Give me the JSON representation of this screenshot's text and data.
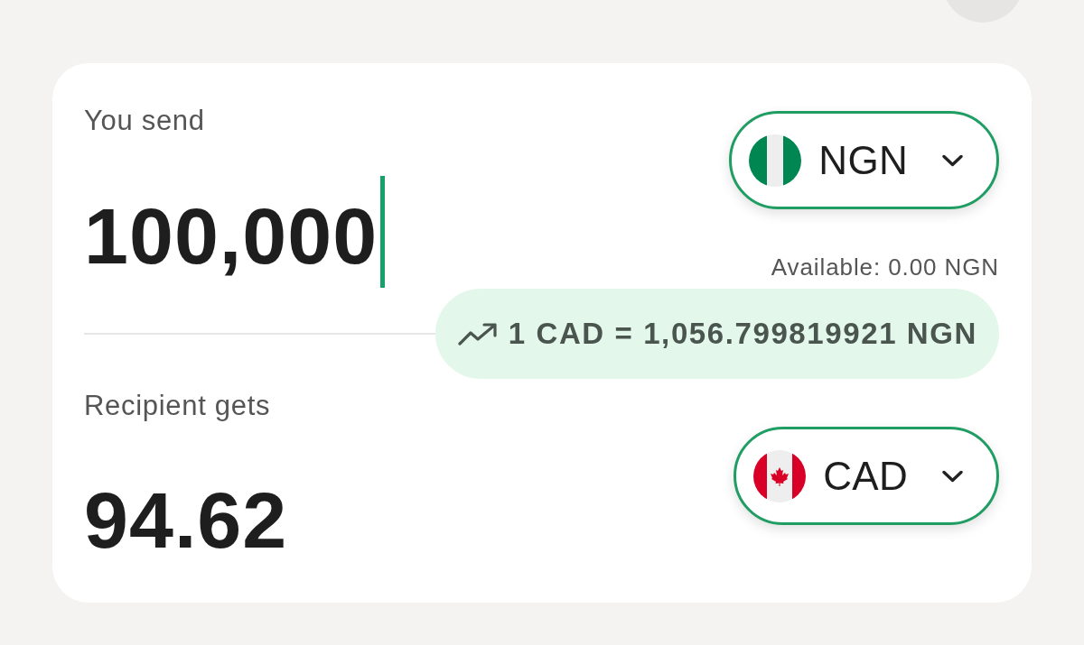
{
  "send": {
    "label": "You send",
    "amount": "100,000",
    "focused": true,
    "currency": {
      "code": "NGN",
      "kind": "nigeria"
    },
    "available": "Available: 0.00 NGN"
  },
  "rate": {
    "text": "1 CAD = 1,056.799819921 NGN"
  },
  "receive": {
    "label": "Recipient gets",
    "amount": "94.62",
    "focused": false,
    "currency": {
      "code": "CAD",
      "kind": "canada"
    }
  }
}
